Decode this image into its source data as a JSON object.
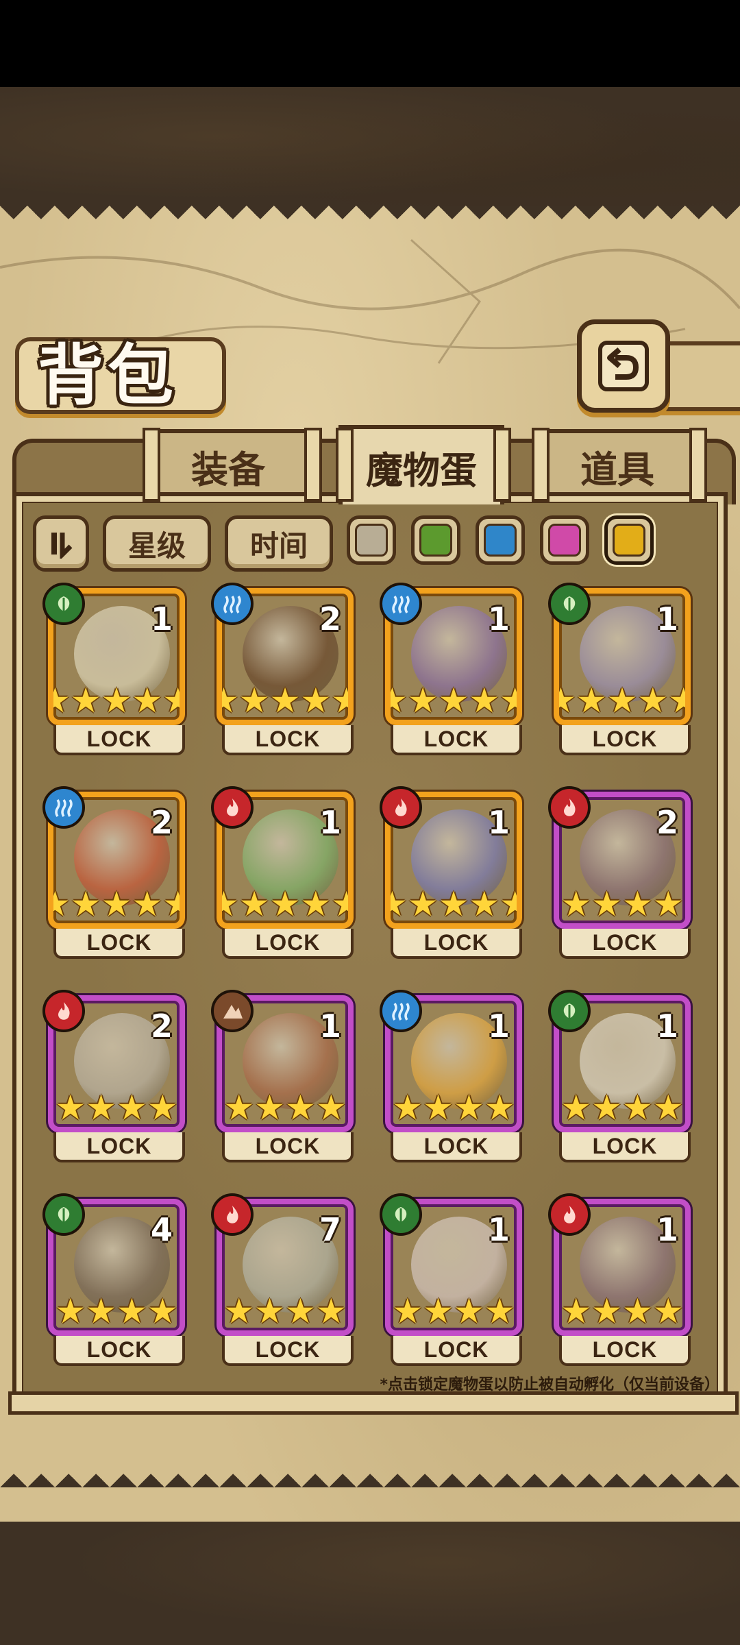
{
  "title": "背包",
  "tabs": [
    {
      "label": "装备"
    },
    {
      "label": "魔物蛋",
      "active": true
    },
    {
      "label": "道具"
    }
  ],
  "filters": {
    "sort_icon": "sort-toggle-icon",
    "star_label": "星级",
    "time_label": "时间",
    "swatches": [
      {
        "name": "gray",
        "color": "#b8ad95"
      },
      {
        "name": "green",
        "color": "#5c9a2e"
      },
      {
        "name": "blue",
        "color": "#2f86c9"
      },
      {
        "name": "pink",
        "color": "#d04aa8"
      },
      {
        "name": "gold",
        "color": "#e2ad18",
        "selected": true
      }
    ]
  },
  "lock_label": "LOCK",
  "items": [
    {
      "count": "1",
      "stars": "★★★★★",
      "rarity": "gold",
      "element": "leaf"
    },
    {
      "count": "2",
      "stars": "★★★★★",
      "rarity": "gold",
      "element": "water"
    },
    {
      "count": "1",
      "stars": "★★★★★",
      "rarity": "gold",
      "element": "water"
    },
    {
      "count": "1",
      "stars": "★★★★★",
      "rarity": "gold",
      "element": "leaf"
    },
    {
      "count": "2",
      "stars": "★★★★★",
      "rarity": "gold",
      "element": "water"
    },
    {
      "count": "1",
      "stars": "★★★★★",
      "rarity": "gold",
      "element": "fire"
    },
    {
      "count": "1",
      "stars": "★★★★★",
      "rarity": "gold",
      "element": "fire"
    },
    {
      "count": "2",
      "stars": "★★★★",
      "rarity": "purple",
      "element": "fire"
    },
    {
      "count": "2",
      "stars": "★★★★",
      "rarity": "purple",
      "element": "fire"
    },
    {
      "count": "1",
      "stars": "★★★★",
      "rarity": "purple",
      "element": "earth"
    },
    {
      "count": "1",
      "stars": "★★★★",
      "rarity": "purple",
      "element": "water"
    },
    {
      "count": "1",
      "stars": "★★★★",
      "rarity": "purple",
      "element": "leaf"
    },
    {
      "count": "4",
      "stars": "★★★★",
      "rarity": "purple",
      "element": "leaf"
    },
    {
      "count": "7",
      "stars": "★★★★",
      "rarity": "purple",
      "element": "fire"
    },
    {
      "count": "1",
      "stars": "★★★★",
      "rarity": "purple",
      "element": "leaf"
    },
    {
      "count": "1",
      "stars": "★★★★",
      "rarity": "purple",
      "element": "fire"
    }
  ],
  "footnote": "*点击锁定魔物蛋以防止被自动孵化（仅当前设备）"
}
